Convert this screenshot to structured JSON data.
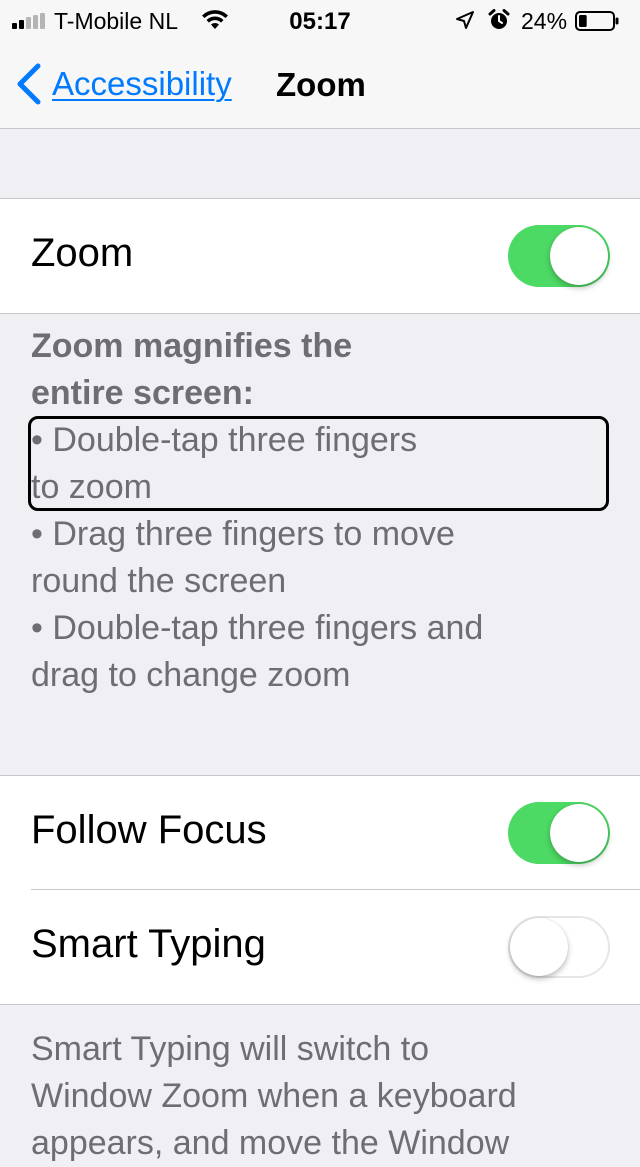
{
  "status_bar": {
    "carrier": "T-Mobile NL",
    "time": "05:17",
    "battery_percent": "24%",
    "battery_level": 0.24,
    "icons": [
      "signal-icon",
      "wifi-icon",
      "location-icon",
      "alarm-icon",
      "battery-icon"
    ]
  },
  "nav": {
    "back_label": "Accessibility",
    "title": "Zoom"
  },
  "zoom_cell": {
    "label": "Zoom",
    "toggle_on": true
  },
  "zoom_description": {
    "heading_line1": "Zoom magnifies the",
    "heading_line2": "entire screen:",
    "bullet1_line1": "•  Double-tap three fingers",
    "bullet1_line2": "to zoom",
    "bullet2_line1": "•  Drag three fingers to move",
    "bullet2_line2": "round the screen",
    "bullet3_line1": "•  Double-tap three fingers and",
    "bullet3_line2": "drag to change zoom"
  },
  "follow_focus": {
    "label": "Follow Focus",
    "toggle_on": true
  },
  "smart_typing": {
    "label": "Smart Typing",
    "toggle_on": false
  },
  "smart_typing_description": {
    "line1": "Smart Typing will switch to",
    "line2": "Window Zoom when a keyboard",
    "line3": "appears, and move the Window"
  },
  "colors": {
    "accent": "#007aff",
    "toggle_on": "#4cd964",
    "background": "#efeff4",
    "footer_text": "#6d6d72"
  }
}
